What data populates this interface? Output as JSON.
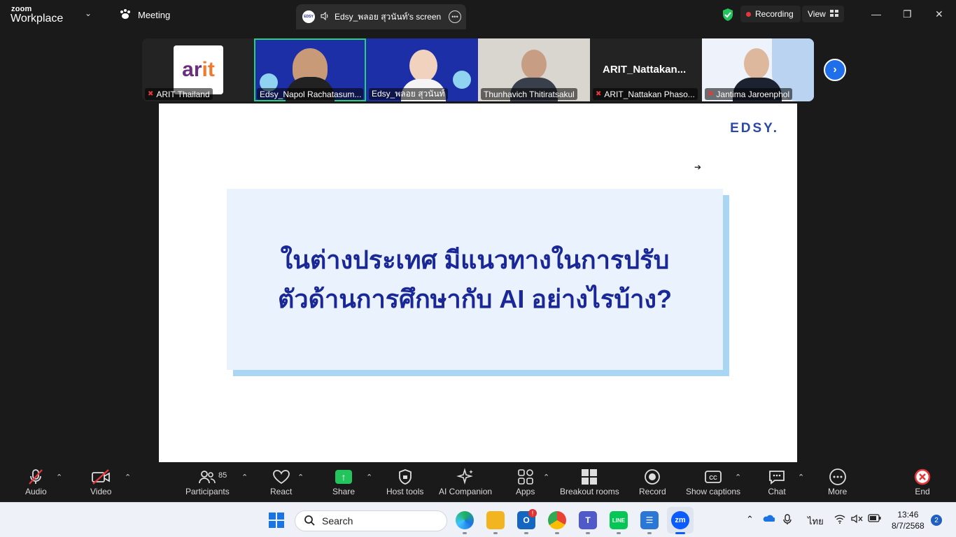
{
  "app": {
    "brand_small": "zoom",
    "brand_big": "Workplace",
    "meeting_label": "Meeting"
  },
  "share": {
    "title": "Edsy_พลอย สุวนันท์'s screen",
    "badge": "EDSY"
  },
  "status": {
    "recording": "Recording",
    "view": "View"
  },
  "participants": [
    {
      "name": "ARIT Thailand",
      "muted": true,
      "logo": "arit"
    },
    {
      "name": "Edsy_Napol Rachatasum...",
      "muted": false,
      "active": true
    },
    {
      "name": "Edsy_พลอย สุวนันท์",
      "muted": false
    },
    {
      "name": "Thunhavich Thitiratsakul",
      "muted": false
    },
    {
      "name": "ARIT_Nattakan Phaso...",
      "muted": true,
      "big_label": "ARIT_Nattakan..."
    },
    {
      "name": "Jantima Jaroenphol",
      "muted": true
    }
  ],
  "slide": {
    "brand": "EDSY.",
    "question_line1": "ในต่างประเทศ มีแนวทางในการปรับ",
    "question_line2": "ตัวด้านการศึกษากับ AI อย่างไรบ้าง?"
  },
  "toolbar": {
    "audio": "Audio",
    "video": "Video",
    "participants": "Participants",
    "participants_count": "85",
    "react": "React",
    "share": "Share",
    "host_tools": "Host tools",
    "ai_companion": "AI Companion",
    "apps": "Apps",
    "breakout": "Breakout rooms",
    "record": "Record",
    "captions": "Show captions",
    "chat": "Chat",
    "more": "More",
    "end": "End"
  },
  "taskbar": {
    "search_placeholder": "Search",
    "lang": "ไทย",
    "time": "13:46",
    "date": "8/7/2568",
    "notifications": "2"
  },
  "colors": {
    "accent_blue": "#1f6feb",
    "share_green": "#23c45e",
    "record_red": "#e8373c",
    "slide_navy": "#1a2797"
  }
}
